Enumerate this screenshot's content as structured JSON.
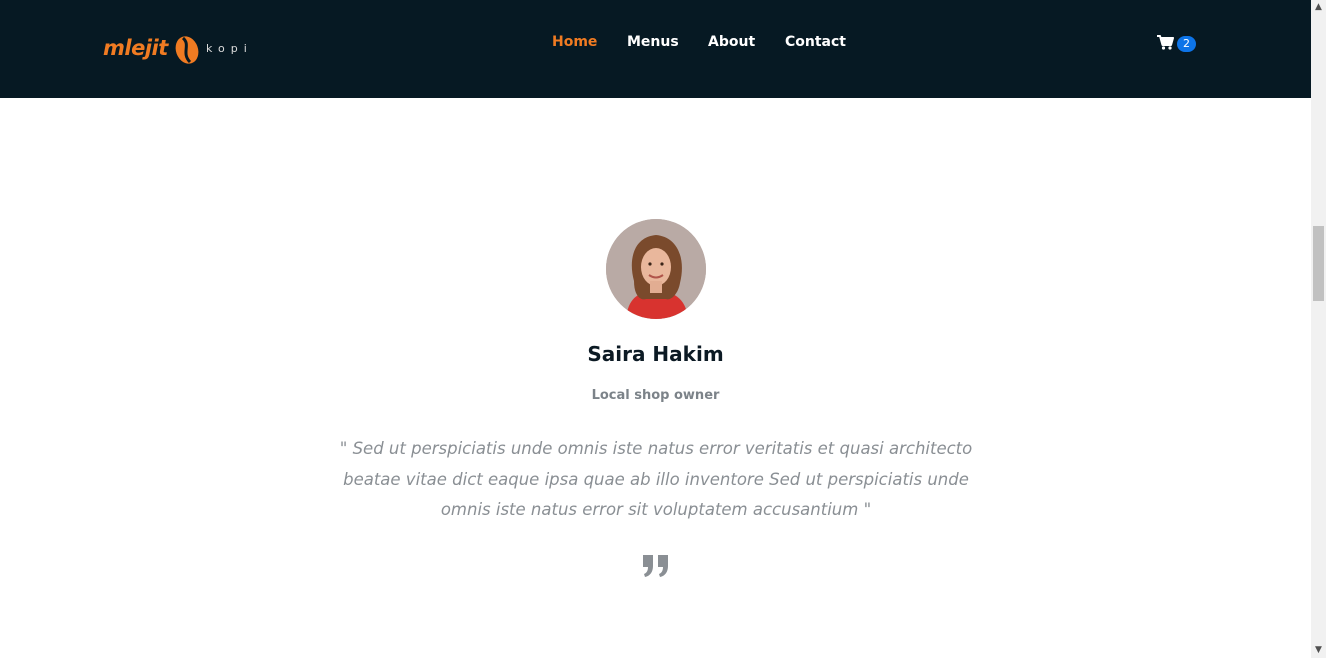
{
  "brand": {
    "logo_main": "mlejit",
    "logo_sub": "kopi"
  },
  "nav": {
    "items": [
      {
        "label": "Home",
        "active": true
      },
      {
        "label": "Menus",
        "active": false
      },
      {
        "label": "About",
        "active": false
      },
      {
        "label": "Contact",
        "active": false
      }
    ]
  },
  "cart": {
    "icon": "cart-icon",
    "count": "2"
  },
  "testimonial": {
    "name": "Saira Hakim",
    "role": "Local shop owner",
    "quote": "\" Sed ut perspiciatis unde omnis iste natus error veritatis et quasi architecto beatae vitae dict eaque ipsa quae ab illo inventore Sed ut perspiciatis unde omnis iste natus error sit voluptatem accusantium \""
  },
  "colors": {
    "header_bg": "#061923",
    "accent": "#f07b22",
    "badge": "#0d74e8"
  }
}
